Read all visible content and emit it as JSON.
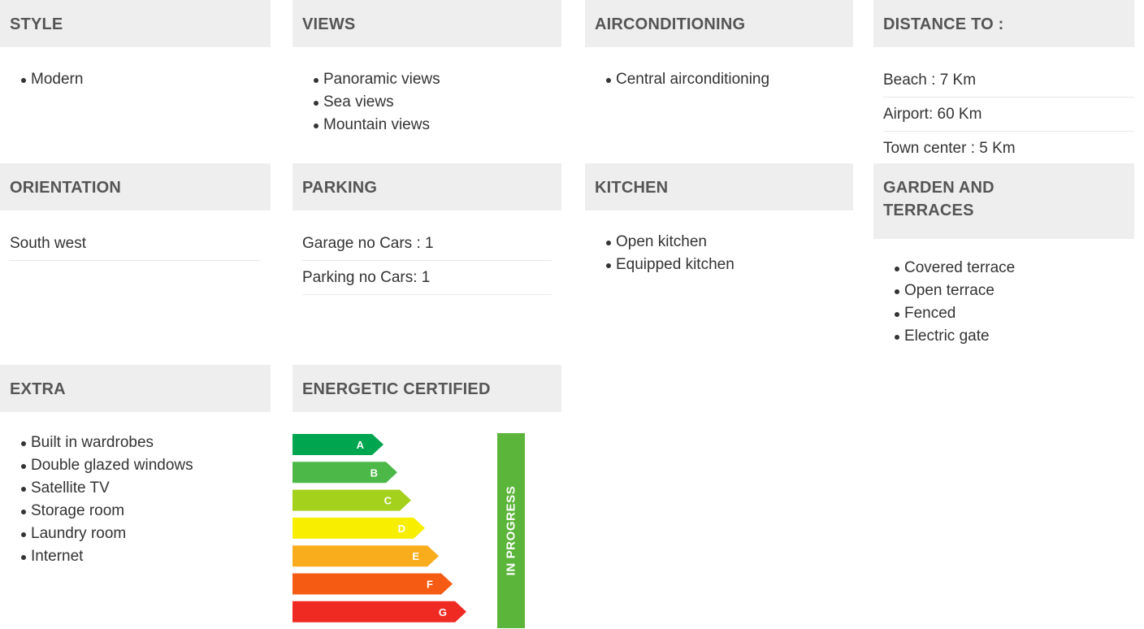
{
  "style": {
    "title": "STYLE",
    "items": [
      "Modern"
    ]
  },
  "views": {
    "title": "VIEWS",
    "items": [
      "Panoramic views",
      "Sea views",
      "Mountain views"
    ]
  },
  "airconditioning": {
    "title": "AIRCONDITIONING",
    "items": [
      "Central airconditioning"
    ]
  },
  "distance": {
    "title": "DISTANCE TO :",
    "rows": [
      "Beach : 7 Km",
      "Airport: 60 Km",
      "Town center : 5 Km"
    ]
  },
  "orientation": {
    "title": "ORIENTATION",
    "rows": [
      "South west"
    ]
  },
  "parking": {
    "title": "PARKING",
    "rows": [
      "Garage no Cars : 1",
      "Parking no Cars: 1"
    ]
  },
  "kitchen": {
    "title": "KITCHEN",
    "items": [
      "Open kitchen",
      "Equipped kitchen"
    ]
  },
  "garden": {
    "title": "GARDEN AND TERRACES",
    "items": [
      "Covered terrace",
      "Open terrace",
      "Fenced",
      "Electric gate"
    ]
  },
  "extra": {
    "title": "EXTRA",
    "items": [
      "Built in wardrobes",
      "Double glazed windows",
      "Satellite TV",
      "Storage room",
      "Laundry room",
      "Internet"
    ]
  },
  "energy": {
    "title": "ENERGETIC CERTIFIED",
    "status": "IN PROGRESS",
    "status_color": "#5bb53a",
    "classes": [
      {
        "label": "A",
        "color": "#00a550"
      },
      {
        "label": "B",
        "color": "#4cb848"
      },
      {
        "label": "C",
        "color": "#a4d11b"
      },
      {
        "label": "D",
        "color": "#f7ee00"
      },
      {
        "label": "E",
        "color": "#f9ad1c"
      },
      {
        "label": "F",
        "color": "#f65b13"
      },
      {
        "label": "G",
        "color": "#ee2a23"
      }
    ]
  }
}
